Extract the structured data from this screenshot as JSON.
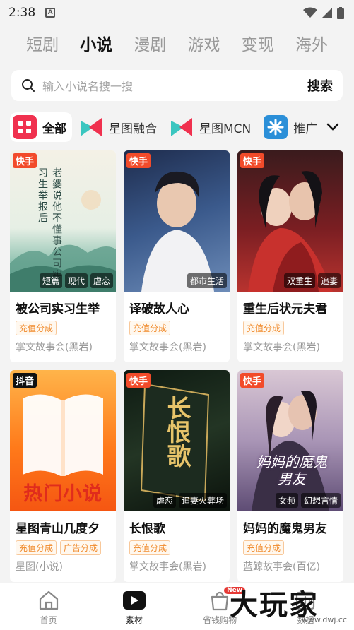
{
  "status_bar": {
    "time": "2:38",
    "a_icon": "A"
  },
  "category_tabs": [
    {
      "label": "短剧",
      "active": false
    },
    {
      "label": "小说",
      "active": true
    },
    {
      "label": "漫剧",
      "active": false
    },
    {
      "label": "游戏",
      "active": false
    },
    {
      "label": "变现",
      "active": false
    },
    {
      "label": "海外",
      "active": false
    }
  ],
  "search": {
    "placeholder": "输入小说名搜一搜",
    "button": "搜索"
  },
  "chips": [
    {
      "label": "全部",
      "icon": "grid-icon",
      "active": true
    },
    {
      "label": "星图融合",
      "icon": "xingtu-logo-icon",
      "active": false
    },
    {
      "label": "星图MCN",
      "icon": "xingtu-logo-icon",
      "active": false
    },
    {
      "label": "推广",
      "icon": "tuiguang-logo-icon",
      "active": false
    }
  ],
  "cards": [
    {
      "platform": "快手",
      "tags": [
        "短篇",
        "现代",
        "虐恋"
      ],
      "title": "被公司实习生举",
      "labels": [
        "充值分成"
      ],
      "source": "掌文故事会(黑岩)"
    },
    {
      "platform": "快手",
      "tags": [
        "都市生活"
      ],
      "title": "译破故人心",
      "labels": [
        "充值分成"
      ],
      "source": "掌文故事会(黑岩)"
    },
    {
      "platform": "快手",
      "tags": [
        "双重生",
        "追妻"
      ],
      "title": "重生后状元夫君",
      "labels": [
        "充值分成"
      ],
      "source": "掌文故事会(黑岩)"
    },
    {
      "platform": "抖音",
      "tags": [],
      "title": "星图青山几度夕",
      "labels": [
        "充值分成",
        "广告分成"
      ],
      "source": "星图(小说)",
      "cover_text": "热门小说"
    },
    {
      "platform": "快手",
      "tags": [
        "虐恋",
        "追妻火葬场"
      ],
      "title": "长恨歌",
      "labels": [
        "充值分成"
      ],
      "source": "掌文故事会(黑岩)",
      "cover_text": "长恨歌"
    },
    {
      "platform": "快手",
      "tags": [
        "女频",
        "幻想言情"
      ],
      "title": "妈妈的魔鬼男友",
      "labels": [
        "充值分成"
      ],
      "source": "蓝鲸故事会(百亿)",
      "cover_text": "妈妈的魔鬼男友"
    }
  ],
  "cover1_text": "老婆说他不懂事公司实习生举报后",
  "bottom_nav": [
    {
      "label": "首页",
      "icon": "home-icon",
      "active": false
    },
    {
      "label": "素材",
      "icon": "play-icon",
      "active": true
    },
    {
      "label": "省钱购物",
      "icon": "shopping-bag-icon",
      "active": false,
      "badge": "New"
    },
    {
      "label": "数据",
      "icon": "data-icon",
      "active": false
    }
  ],
  "watermark": {
    "text": "大玩家",
    "url": "www.dwj.cc"
  },
  "colors": {
    "kuaishou": "#f24b2a",
    "douyin": "#111111",
    "orange_label": "#f08a2b",
    "accent": "#e53935"
  }
}
